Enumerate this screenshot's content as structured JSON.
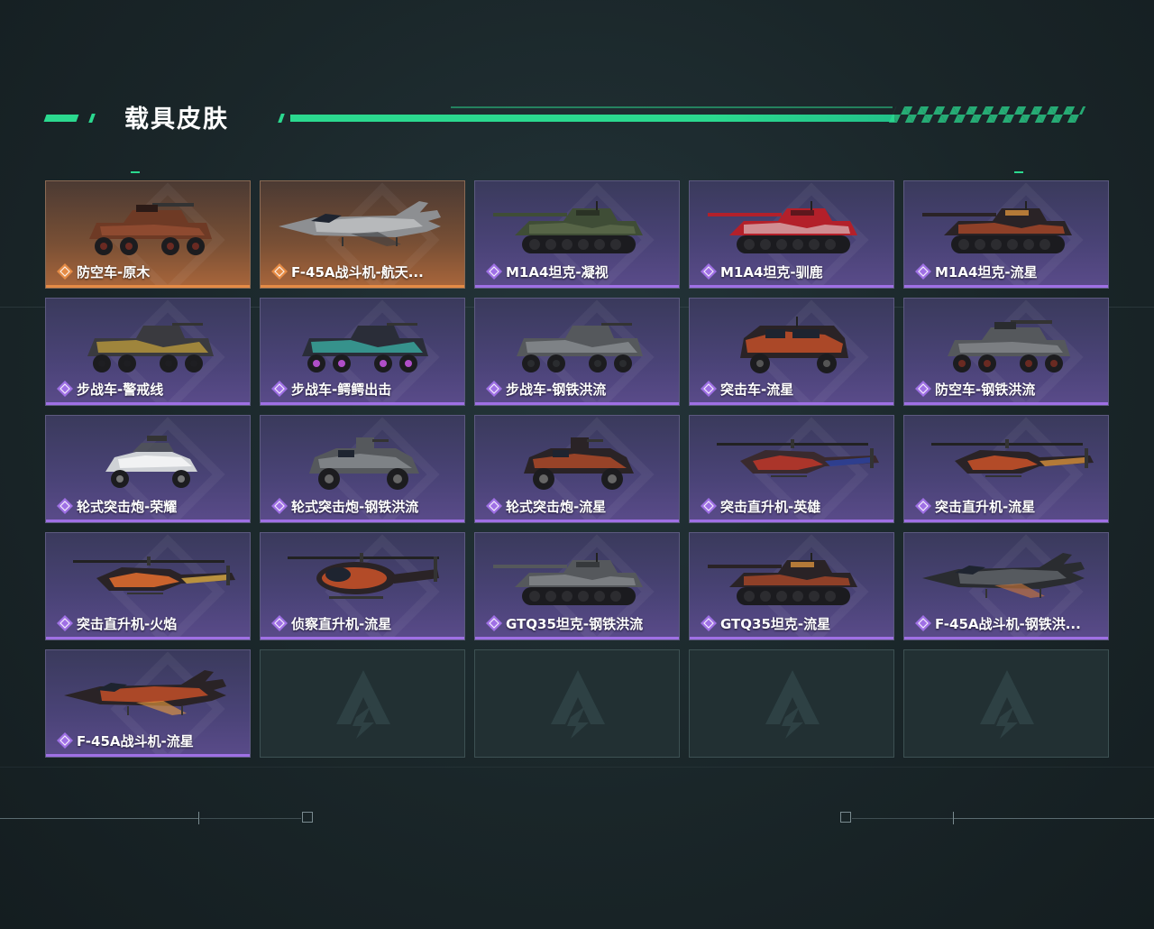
{
  "page": {
    "title": "载具皮肤"
  },
  "colors": {
    "accent": "#2bd98f",
    "epic": "#9f70e5",
    "legendary": "#e58b45"
  },
  "rarity_icon": "diamond-rarity-icon",
  "empty_slot_icon": "game-logo-watermark-icon",
  "skins": [
    {
      "name": "防空车-原木",
      "rarity": "legendary",
      "vehicle": "aa-truck",
      "livery": "wood"
    },
    {
      "name": "F-45A战斗机-航天...",
      "rarity": "legendary",
      "vehicle": "jet",
      "livery": "grey"
    },
    {
      "name": "M1A4坦克-凝视",
      "rarity": "epic",
      "vehicle": "tank",
      "livery": "green"
    },
    {
      "name": "M1A4坦克-驯鹿",
      "rarity": "epic",
      "vehicle": "tank",
      "livery": "red"
    },
    {
      "name": "M1A4坦克-流星",
      "rarity": "epic",
      "vehicle": "tank",
      "livery": "fire"
    },
    {
      "name": "步战车-警戒线",
      "rarity": "epic",
      "vehicle": "ifv",
      "livery": "stripe"
    },
    {
      "name": "步战车-鳄鳄出击",
      "rarity": "epic",
      "vehicle": "ifv",
      "livery": "graffiti"
    },
    {
      "name": "步战车-钢铁洪流",
      "rarity": "epic",
      "vehicle": "ifv",
      "livery": "steel"
    },
    {
      "name": "突击车-流星",
      "rarity": "epic",
      "vehicle": "truck",
      "livery": "fire"
    },
    {
      "name": "防空车-钢铁洪流",
      "rarity": "epic",
      "vehicle": "aa-truck",
      "livery": "steel"
    },
    {
      "name": "轮式突击炮-荣耀",
      "rarity": "epic",
      "vehicle": "buggy",
      "livery": "white"
    },
    {
      "name": "轮式突击炮-钢铁洪流",
      "rarity": "epic",
      "vehicle": "armored-car",
      "livery": "steel"
    },
    {
      "name": "轮式突击炮-流星",
      "rarity": "epic",
      "vehicle": "armored-car",
      "livery": "fire"
    },
    {
      "name": "突击直升机-英雄",
      "rarity": "epic",
      "vehicle": "heli",
      "livery": "hero"
    },
    {
      "name": "突击直升机-流星",
      "rarity": "epic",
      "vehicle": "heli",
      "livery": "fire"
    },
    {
      "name": "突击直升机-火焰",
      "rarity": "epic",
      "vehicle": "heli",
      "livery": "flame"
    },
    {
      "name": "侦察直升机-流星",
      "rarity": "epic",
      "vehicle": "scout-heli",
      "livery": "fire"
    },
    {
      "name": "GTQ35坦克-钢铁洪流",
      "rarity": "epic",
      "vehicle": "tank",
      "livery": "steel"
    },
    {
      "name": "GTQ35坦克-流星",
      "rarity": "epic",
      "vehicle": "tank",
      "livery": "fire"
    },
    {
      "name": "F-45A战斗机-钢铁洪...",
      "rarity": "epic",
      "vehicle": "jet",
      "livery": "dark"
    },
    {
      "name": "F-45A战斗机-流星",
      "rarity": "epic",
      "vehicle": "jet",
      "livery": "fire"
    },
    {
      "name": "",
      "rarity": "empty"
    },
    {
      "name": "",
      "rarity": "empty"
    },
    {
      "name": "",
      "rarity": "empty"
    },
    {
      "name": "",
      "rarity": "empty"
    }
  ]
}
